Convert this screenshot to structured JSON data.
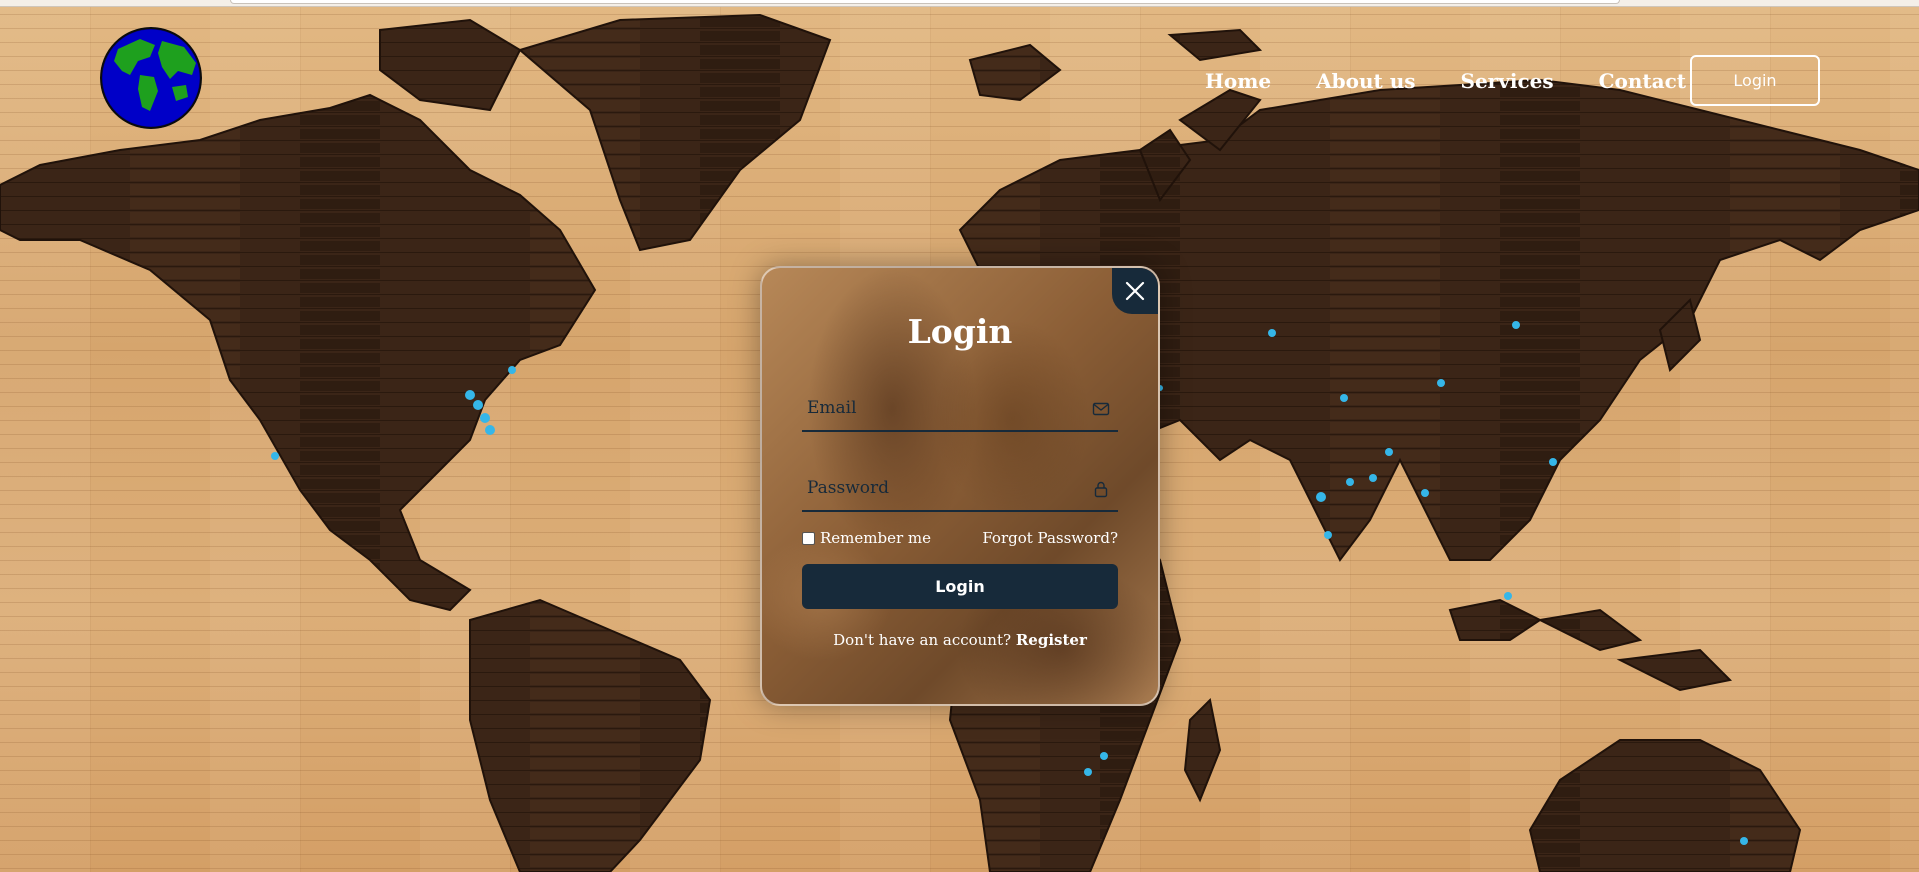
{
  "header": {
    "logo": "globe-logo",
    "nav": [
      {
        "label": "Home"
      },
      {
        "label": "About us"
      },
      {
        "label": "Services"
      },
      {
        "label": "Contact"
      }
    ],
    "login_button": "Login"
  },
  "modal": {
    "title": "Login",
    "email_placeholder": "Email",
    "email_icon": "mail-icon",
    "password_placeholder": "Password",
    "password_icon": "lock-icon",
    "remember_label": "Remember me",
    "remember_checked": false,
    "forgot_label": "Forgot Password?",
    "submit_label": "Login",
    "register_prompt": "Don't have an account?",
    "register_link": "Register",
    "close_icon": "close-icon"
  },
  "colors": {
    "primary": "#172a3a",
    "text_light": "#ffffff",
    "wood_light": "#dcae78",
    "continent": "#3a2417",
    "globe_water": "#0000c8",
    "globe_land": "#1ea01e"
  }
}
